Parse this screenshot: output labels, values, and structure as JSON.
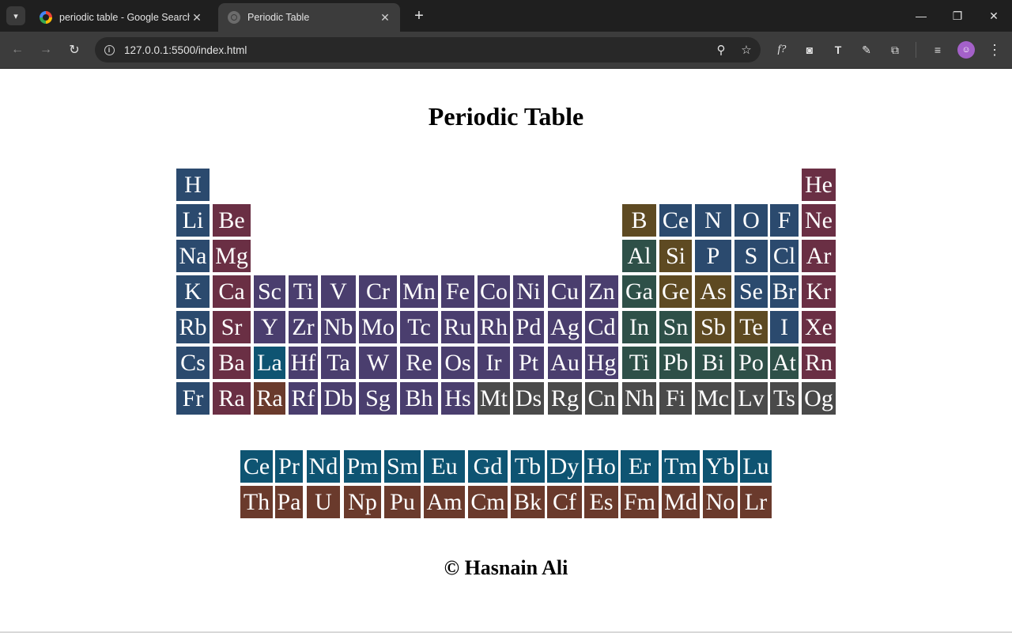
{
  "browser": {
    "tabs": [
      {
        "title": "periodic table - Google Search",
        "icon": "google-icon"
      },
      {
        "title": "Periodic Table",
        "icon": "globe-icon"
      }
    ],
    "url": "127.0.0.1:5500/index.html",
    "window_controls": {
      "minimize": "—",
      "restore": "❐",
      "close": "✕"
    }
  },
  "page": {
    "title": "Periodic Table",
    "footer": "© Hasnain Ali"
  },
  "colors": {
    "nonmetal": "#2b4a6e",
    "alkaline": "#6a2f44",
    "transition": "#4a3e6e",
    "metalloid": "#5e4a22",
    "post_transition": "#2e5048",
    "unknown": "#4a4a4a",
    "lanthanide": "#0e5472",
    "actinide": "#6a3a2c"
  },
  "main_table": [
    [
      "H",
      "",
      "",
      "",
      "",
      "",
      "",
      "",
      "",
      "",
      "",
      "",
      "",
      "",
      "",
      "",
      "",
      "He"
    ],
    [
      "Li",
      "Be",
      "",
      "",
      "",
      "",
      "",
      "",
      "",
      "",
      "",
      "",
      "B",
      "Ce",
      "N",
      "O",
      "F",
      "Ne"
    ],
    [
      "Na",
      "Mg",
      "",
      "",
      "",
      "",
      "",
      "",
      "",
      "",
      "",
      "",
      "Al",
      "Si",
      "P",
      "S",
      "Cl",
      "Ar"
    ],
    [
      "K",
      "Ca",
      "Sc",
      "Ti",
      "V",
      "Cr",
      "Mn",
      "Fe",
      "Co",
      "Ni",
      "Cu",
      "Zn",
      "Ga",
      "Ge",
      "As",
      "Se",
      "Br",
      "Kr"
    ],
    [
      "Rb",
      "Sr",
      "Y",
      "Zr",
      "Nb",
      "Mo",
      "Tc",
      "Ru",
      "Rh",
      "Pd",
      "Ag",
      "Cd",
      "In",
      "Sn",
      "Sb",
      "Te",
      "I",
      "Xe"
    ],
    [
      "Cs",
      "Ba",
      "La",
      "Hf",
      "Ta",
      "W",
      "Re",
      "Os",
      "Ir",
      "Pt",
      "Au",
      "Hg",
      "Ti",
      "Pb",
      "Bi",
      "Po",
      "At",
      "Rn"
    ],
    [
      "Fr",
      "Ra",
      "Ra",
      "Rf",
      "Db",
      "Sg",
      "Bh",
      "Hs",
      "Mt",
      "Ds",
      "Rg",
      "Cn",
      "Nh",
      "Fi",
      "Mc",
      "Lv",
      "Ts",
      "Og"
    ]
  ],
  "main_table_categories": [
    [
      "nonmetal",
      "",
      "",
      "",
      "",
      "",
      "",
      "",
      "",
      "",
      "",
      "",
      "",
      "",
      "",
      "",
      "",
      "alkaline"
    ],
    [
      "nonmetal",
      "alkaline",
      "",
      "",
      "",
      "",
      "",
      "",
      "",
      "",
      "",
      "",
      "metalloid",
      "nonmetal",
      "nonmetal",
      "nonmetal",
      "nonmetal",
      "alkaline"
    ],
    [
      "nonmetal",
      "alkaline",
      "",
      "",
      "",
      "",
      "",
      "",
      "",
      "",
      "",
      "",
      "post_transition",
      "metalloid",
      "nonmetal",
      "nonmetal",
      "nonmetal",
      "alkaline"
    ],
    [
      "nonmetal",
      "alkaline",
      "transition",
      "transition",
      "transition",
      "transition",
      "transition",
      "transition",
      "transition",
      "transition",
      "transition",
      "transition",
      "post_transition",
      "metalloid",
      "metalloid",
      "nonmetal",
      "nonmetal",
      "alkaline"
    ],
    [
      "nonmetal",
      "alkaline",
      "transition",
      "transition",
      "transition",
      "transition",
      "transition",
      "transition",
      "transition",
      "transition",
      "transition",
      "transition",
      "post_transition",
      "post_transition",
      "metalloid",
      "metalloid",
      "nonmetal",
      "alkaline"
    ],
    [
      "nonmetal",
      "alkaline",
      "lanthanide",
      "transition",
      "transition",
      "transition",
      "transition",
      "transition",
      "transition",
      "transition",
      "transition",
      "transition",
      "post_transition",
      "post_transition",
      "post_transition",
      "post_transition",
      "post_transition",
      "alkaline"
    ],
    [
      "nonmetal",
      "alkaline",
      "actinide",
      "transition",
      "transition",
      "transition",
      "transition",
      "transition",
      "unknown",
      "unknown",
      "unknown",
      "unknown",
      "unknown",
      "unknown",
      "unknown",
      "unknown",
      "unknown",
      "unknown"
    ]
  ],
  "f_block": [
    [
      "Ce",
      "Pr",
      "Nd",
      "Pm",
      "Sm",
      "Eu",
      "Gd",
      "Tb",
      "Dy",
      "Ho",
      "Er",
      "Tm",
      "Yb",
      "Lu"
    ],
    [
      "Th",
      "Pa",
      "U",
      "Np",
      "Pu",
      "Am",
      "Cm",
      "Bk",
      "Cf",
      "Es",
      "Fm",
      "Md",
      "No",
      "Lr"
    ]
  ],
  "f_block_categories": [
    "lanthanide",
    "actinide"
  ]
}
